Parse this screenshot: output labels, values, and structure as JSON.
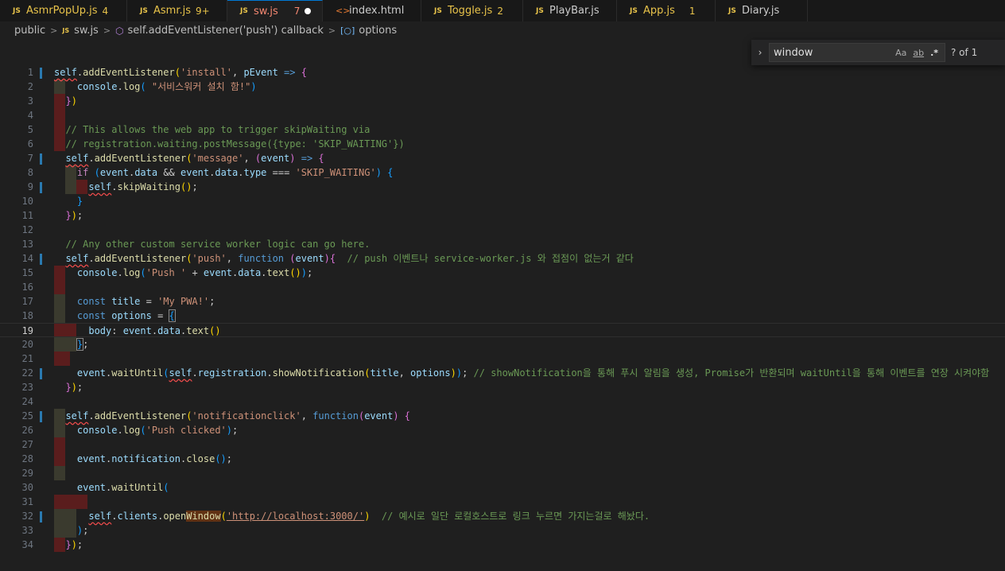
{
  "tabs": [
    {
      "name": "AsmrPopUp.js",
      "badge": "4",
      "type": "js"
    },
    {
      "name": "Asmr.js",
      "badge": "9+",
      "type": "js"
    },
    {
      "name": "sw.js",
      "badge": "7",
      "type": "js",
      "active": true,
      "dirty": true
    },
    {
      "name": "index.html",
      "badge": "",
      "type": "html"
    },
    {
      "name": "Toggle.js",
      "badge": "2",
      "type": "js"
    },
    {
      "name": "PlayBar.js",
      "badge": "",
      "type": "js"
    },
    {
      "name": "App.js",
      "badge": "1",
      "type": "js"
    },
    {
      "name": "Diary.js",
      "badge": "",
      "type": "js"
    }
  ],
  "file_icon_text": "JS",
  "breadcrumb": {
    "folder": "public",
    "file": "sw.js",
    "symbol": "self.addEventListener('push') callback",
    "field": "options"
  },
  "find": {
    "value": "window",
    "match_case": "Aa",
    "whole_word": "ab",
    "regex": ".*",
    "result": "? of 1"
  },
  "editor": {
    "current_line": 19,
    "line_numbers": [
      "1",
      "2",
      "3",
      "4",
      "5",
      "6",
      "7",
      "8",
      "9",
      "10",
      "11",
      "12",
      "13",
      "14",
      "15",
      "16",
      "17",
      "18",
      "19",
      "20",
      "21",
      "22",
      "23",
      "24",
      "25",
      "26",
      "27",
      "28",
      "29",
      "30",
      "31",
      "32",
      "33",
      "34"
    ],
    "strings": {
      "l1": "'install'",
      "l2": "\"서비스워커 설치 함!\"",
      "l5": "// This allows the web app to trigger skipWaiting via",
      "l6": "// registration.waiting.postMessage({type: 'SKIP_WAITING'})",
      "l7": "'message'",
      "l8": "'SKIP_WAITING'",
      "l13": "// Any other custom service worker logic can go here.",
      "l14s": "'push'",
      "l14c": "// push 이벤트나 service-worker.js 와 접점이 없는거 같다",
      "l15": "'Push '",
      "l17": "'My PWA!'",
      "l22c": "// showNotification을 통해 푸시 알림을 생성, Promise가 반환되며 waitUntil을 통해 이벤트를 연장 시켜야함",
      "l25": "'notificationclick'",
      "l26": "'Push clicked'",
      "l32s": "'http://localhost:3000/'",
      "l32c": "// 예시로 일단 로컬호스트로 링크 누르면 가지는걸로 해놨다."
    }
  }
}
